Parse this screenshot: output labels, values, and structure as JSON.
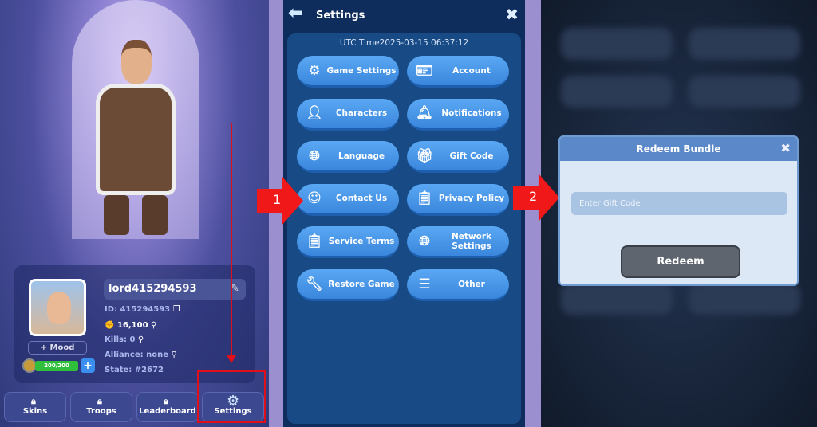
{
  "profile": {
    "name": "lord415294593",
    "id": "ID: 415294593",
    "power": "16,100",
    "kills": "Kills: 0",
    "alliance": "Alliance: none",
    "state": "State: #2672",
    "mood": "+ Mood",
    "stamina": "200/200"
  },
  "bottom_nav": [
    {
      "label": "Skins",
      "locked": true
    },
    {
      "label": "Troops",
      "locked": true
    },
    {
      "label": "Leaderboard",
      "locked": true
    },
    {
      "label": "Settings",
      "locked": false
    }
  ],
  "settings": {
    "title": "Settings",
    "utc": "UTC Time2025-03-15 06:37:12",
    "buttons": [
      {
        "label": "Game Settings",
        "icon": "gear-icon"
      },
      {
        "label": "Account",
        "icon": "id-card-icon"
      },
      {
        "label": "Characters",
        "icon": "person-icon"
      },
      {
        "label": "Notifications",
        "icon": "bell-icon"
      },
      {
        "label": "Language",
        "icon": "globe-icon"
      },
      {
        "label": "Gift Code",
        "icon": "gift-icon"
      },
      {
        "label": "Contact Us",
        "icon": "headset-icon"
      },
      {
        "label": "Privacy Policy",
        "icon": "document-shield-icon"
      },
      {
        "label": "Service Terms",
        "icon": "clipboard-icon"
      },
      {
        "label": "Network Settings",
        "icon": "globe-icon"
      },
      {
        "label": "Restore Game",
        "icon": "wrench-icon"
      },
      {
        "label": "Other",
        "icon": "list-icon"
      }
    ]
  },
  "steps": [
    "1",
    "2"
  ],
  "redeem": {
    "title": "Redeem Bundle",
    "placeholder": "Enter Gift Code",
    "button": "Redeem"
  },
  "colors": {
    "highlight": "#e0101a",
    "button_blue": "#3d8fe0",
    "panel_navy": "#0e2c5c"
  }
}
